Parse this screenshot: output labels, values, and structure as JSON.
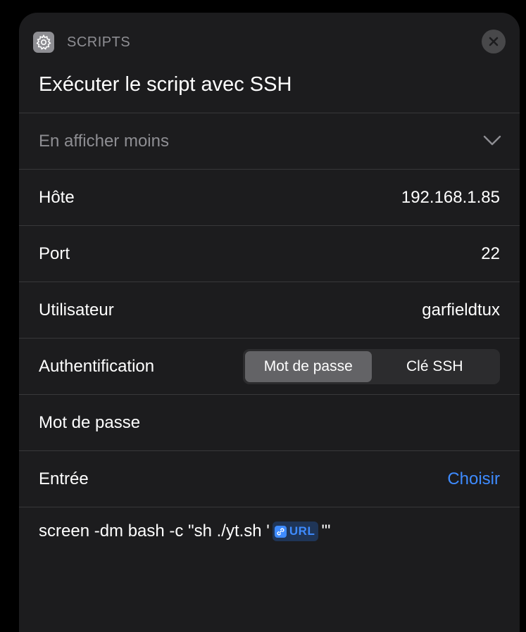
{
  "header": {
    "category": "SCRIPTS",
    "title": "Exécuter le script avec SSH"
  },
  "collapse": {
    "label": "En afficher moins"
  },
  "fields": {
    "host": {
      "label": "Hôte",
      "value": "192.168.1.85"
    },
    "port": {
      "label": "Port",
      "value": "22"
    },
    "user": {
      "label": "Utilisateur",
      "value": "garfieldtux"
    },
    "auth": {
      "label": "Authentification",
      "options": [
        "Mot de passe",
        "Clé SSH"
      ],
      "selected": "Mot de passe"
    },
    "password": {
      "label": "Mot de passe",
      "value": ""
    },
    "input": {
      "label": "Entrée",
      "action": "Choisir"
    }
  },
  "script": {
    "before": "screen -dm bash -c \"sh ./yt.sh '",
    "variable": "URL",
    "after": "'\""
  },
  "colors": {
    "background": "#000000",
    "card": "#1c1c1e",
    "separator": "#38383a",
    "secondary_text": "#8e8e93",
    "accent": "#3e8bff",
    "segment_selected": "#636366"
  },
  "icons": {
    "app": "gear-icon",
    "close": "close-icon",
    "collapse": "chevron-down-icon",
    "variable": "link-icon"
  }
}
